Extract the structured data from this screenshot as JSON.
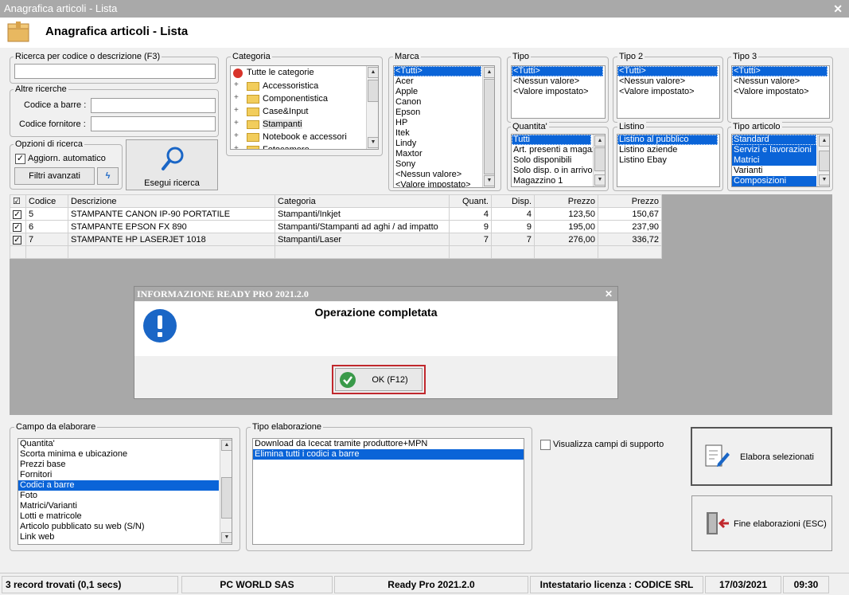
{
  "window": {
    "title": "Anagrafica articoli  - Lista",
    "close": "✕"
  },
  "header": {
    "title": "Anagrafica articoli  - Lista"
  },
  "search": {
    "label": "Ricerca per codice o descrizione (F3)",
    "value": "",
    "other_label": "Altre ricerche",
    "barcode_label": "Codice a barre :",
    "supplier_label": "Codice fornitore :",
    "options_label": "Opzioni di ricerca",
    "auto_update": "Aggiorn. automatico",
    "advanced_filters": "Filtri avanzati",
    "run_search": "Esegui ricerca"
  },
  "categoria": {
    "label": "Categoria",
    "items": [
      "Tutte le categorie",
      "Accessoristica",
      "Componentistica",
      "Case&Input",
      "Stampanti",
      "Notebook e accessori",
      "Fotocamere"
    ],
    "selected": "Stampanti"
  },
  "marca": {
    "label": "Marca",
    "items": [
      "<Tutti>",
      "Acer",
      "Apple",
      "Canon",
      "Epson",
      "HP",
      "Itek",
      "Lindy",
      "Maxtor",
      "Sony",
      "<Nessun valore>",
      "<Valore impostato>"
    ],
    "selected": "<Tutti>"
  },
  "tipo": {
    "label": "Tipo",
    "items": [
      "<Tutti>",
      "<Nessun valore>",
      "<Valore impostato>"
    ]
  },
  "tipo2": {
    "label": "Tipo 2",
    "items": [
      "<Tutti>",
      "<Nessun valore>",
      "<Valore impostato>"
    ]
  },
  "tipo3": {
    "label": "Tipo 3",
    "items": [
      "<Tutti>",
      "<Nessun valore>",
      "<Valore impostato>"
    ]
  },
  "quantita": {
    "label": "Quantita'",
    "items": [
      "Tutti",
      "Art. presenti a magazzino",
      "Solo disponibili",
      "Solo disp. o in arrivo",
      "Magazzino 1"
    ]
  },
  "listino": {
    "label": "Listino",
    "items": [
      "Listino al pubblico",
      "Listino aziende",
      "Listino Ebay"
    ]
  },
  "tipo_articolo": {
    "label": "Tipo articolo",
    "items": [
      "Standard",
      "Servizi e lavorazioni",
      "Matrici",
      "Varianti",
      "Composizioni"
    ]
  },
  "table": {
    "headers": [
      "Codice",
      "Descrizione",
      "Categoria",
      "Quant.",
      "Disp.",
      "Prezzo",
      "Prezzo"
    ],
    "rows": [
      [
        "5",
        "STAMPANTE CANON IP-90 PORTATILE",
        "Stampanti/Inkjet",
        "4",
        "4",
        "123,50",
        "150,67"
      ],
      [
        "6",
        "STAMPANTE EPSON FX 890",
        "Stampanti/Stampanti ad aghi / ad impatto",
        "9",
        "9",
        "195,00",
        "237,90"
      ],
      [
        "7",
        "STAMPANTE HP LASERJET 1018",
        "Stampanti/Laser",
        "7",
        "7",
        "276,00",
        "336,72"
      ]
    ]
  },
  "dialog": {
    "title": "INFORMAZIONE READY PRO 2021.2.0",
    "message": "Operazione completata",
    "ok": "OK (F12)",
    "close": "✕"
  },
  "campo": {
    "label": "Campo da elaborare",
    "items": [
      "Quantita'",
      "Scorta minima e ubicazione",
      "Prezzi base",
      "Fornitori",
      "Codici a barre",
      "Foto",
      "Matrici/Varianti",
      "Lotti e matricole",
      "Articolo pubblicato su web (S/N)",
      "Link web"
    ],
    "selected": "Codici a barre"
  },
  "tipo_elab": {
    "label": "Tipo elaborazione",
    "items": [
      "Download da Icecat tramite produttore+MPN",
      "Elimina tutti i codici a barre"
    ],
    "selected": "Elimina tutti i codici a barre"
  },
  "support": {
    "label": "Visualizza campi di supporto"
  },
  "actions": {
    "process": "Elabora selezionati",
    "end": "Fine elaborazioni (ESC)"
  },
  "status": {
    "records": "3 record trovati (0,1 secs)",
    "company": "PC WORLD SAS",
    "version": "Ready Pro 2021.2.0",
    "license": "Intestatario licenza : CODICE SRL",
    "date": "17/03/2021",
    "time": "09:30"
  },
  "colors": {
    "selection": "#0a64d8",
    "titlebar": "#a9a9a9",
    "highlight": "#c0282d",
    "ok_icon": "#3a9a4a",
    "info_icon": "#1a66c6"
  }
}
